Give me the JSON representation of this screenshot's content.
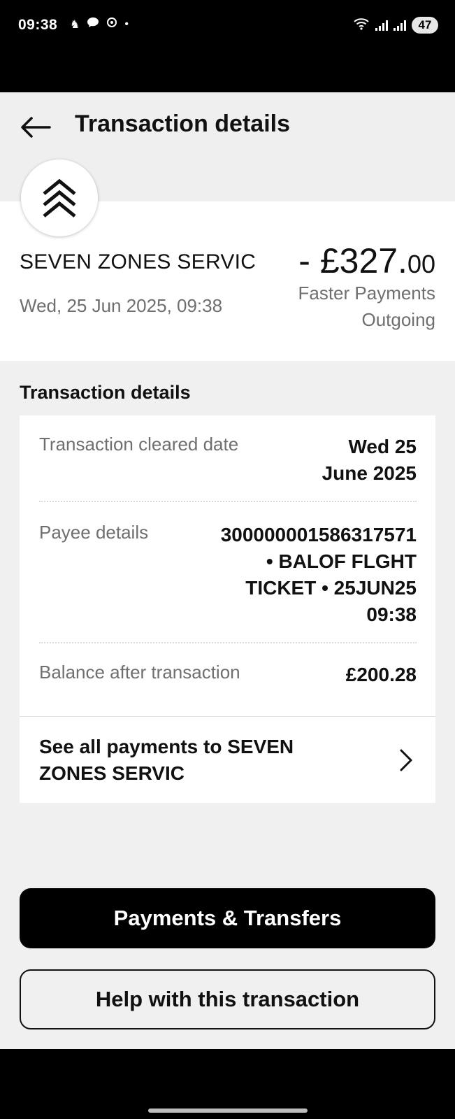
{
  "status_bar": {
    "time": "09:38",
    "battery": "47",
    "notification_icons": [
      "horse-icon",
      "chat-icon",
      "nfc-icon",
      "dot-icon"
    ]
  },
  "header": {
    "title": "Transaction details"
  },
  "summary": {
    "merchant": "SEVEN ZONES SERVIC",
    "date": "Wed, 25 Jun 2025, 09:38",
    "amount_main": "- £327.",
    "amount_cents": "00",
    "payment_type": "Faster Payments Outgoing"
  },
  "details": {
    "section_title": "Transaction details",
    "cleared_label": "Transaction cleared date",
    "cleared_value_line1": "Wed 25",
    "cleared_value_line2": "June 2025",
    "payee_label": "Payee details",
    "payee_line1": "300000001586317571",
    "payee_line2": "• BALOF FLGHT",
    "payee_line3": "TICKET • 25JUN25",
    "payee_line4": "09:38",
    "balance_label": "Balance after transaction",
    "balance_value": "£200.28",
    "see_all_line1": "See all payments to SEVEN",
    "see_all_line2": "ZONES SERVIC"
  },
  "actions": {
    "primary": "Payments & Transfers",
    "secondary": "Help with this transaction"
  },
  "colors": {
    "accent": "#000000",
    "background": "#f0f0f0",
    "muted_text": "#6f6f6f"
  }
}
